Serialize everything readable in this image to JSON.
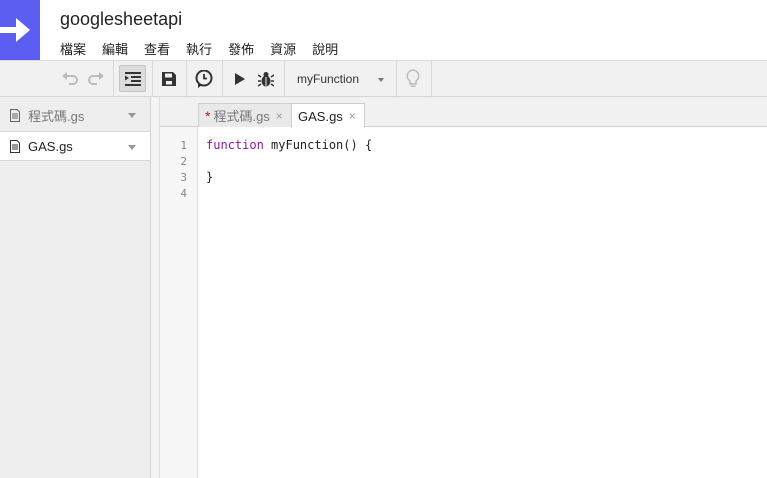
{
  "app": {
    "project_title": "googlesheetapi",
    "logo_icon": "arrow-right-icon",
    "brand_color": "#5b5ef0"
  },
  "menu": {
    "items": [
      "檔案",
      "編輯",
      "查看",
      "執行",
      "發佈",
      "資源",
      "說明"
    ]
  },
  "toolbar": {
    "buttons": [
      "undo-icon",
      "redo-icon",
      "indent-icon",
      "save-icon",
      "clock-icon",
      "play-icon",
      "bug-icon",
      "lightbulb-icon"
    ],
    "function_select": {
      "value": "myFunction"
    }
  },
  "files": [
    {
      "name": "程式碼.gs",
      "selected": false
    },
    {
      "name": "GAS.gs",
      "selected": true
    }
  ],
  "tabs": [
    {
      "label": "程式碼.gs",
      "unsaved_marker": "*",
      "close": "×"
    },
    {
      "label": "GAS.gs",
      "close": "×"
    }
  ],
  "editor": {
    "line_numbers": [
      "1",
      "2",
      "3",
      "4"
    ],
    "lines": {
      "l1_keyword": "function",
      "l1_rest": " myFunction() {",
      "l3": "}"
    },
    "keyword_color": "#8a1a9c"
  }
}
